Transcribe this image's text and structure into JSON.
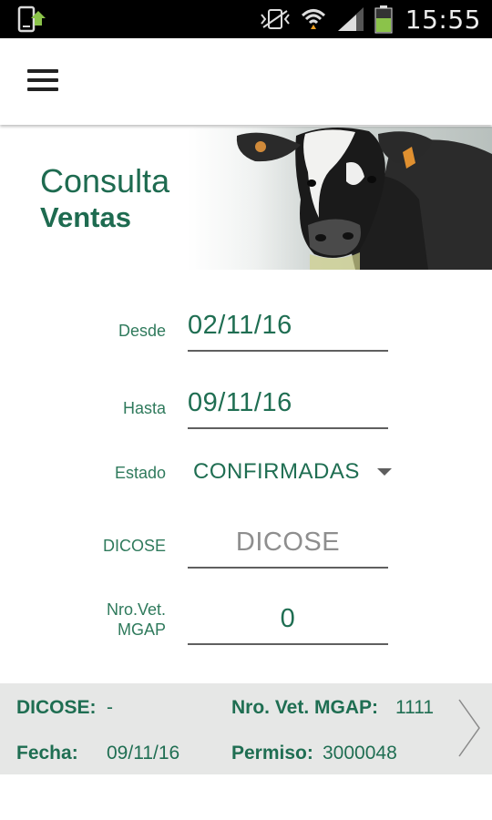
{
  "status_bar": {
    "time": "15:55",
    "icons": [
      "phone-update-icon",
      "vibrate-icon",
      "wifi-icon",
      "signal-icon",
      "battery-icon"
    ]
  },
  "app_bar": {
    "menu_icon": "hamburger-menu-icon"
  },
  "banner": {
    "title_line1": "Consulta",
    "title_line2": "Ventas"
  },
  "form": {
    "desde": {
      "label": "Desde",
      "value": "02/11/16"
    },
    "hasta": {
      "label": "Hasta",
      "value": "09/11/16"
    },
    "estado": {
      "label": "Estado",
      "value": "CONFIRMADAS"
    },
    "dicose": {
      "label": "DICOSE",
      "placeholder": "DICOSE"
    },
    "nro_vet": {
      "label_line1": "Nro.Vet.",
      "label_line2": "MGAP",
      "value": "0"
    }
  },
  "result": {
    "dicose_label": "DICOSE:",
    "dicose_value": "-",
    "nro_vet_label": "Nro. Vet. MGAP:",
    "nro_vet_value": "1111",
    "fecha_label": "Fecha:",
    "fecha_value": "09/11/16",
    "permiso_label": "Permiso:",
    "permiso_value": "3000048"
  },
  "colors": {
    "brand_green": "#1f6e52",
    "label_green": "#2f7a5c",
    "card_bg": "#e6e7e6"
  }
}
